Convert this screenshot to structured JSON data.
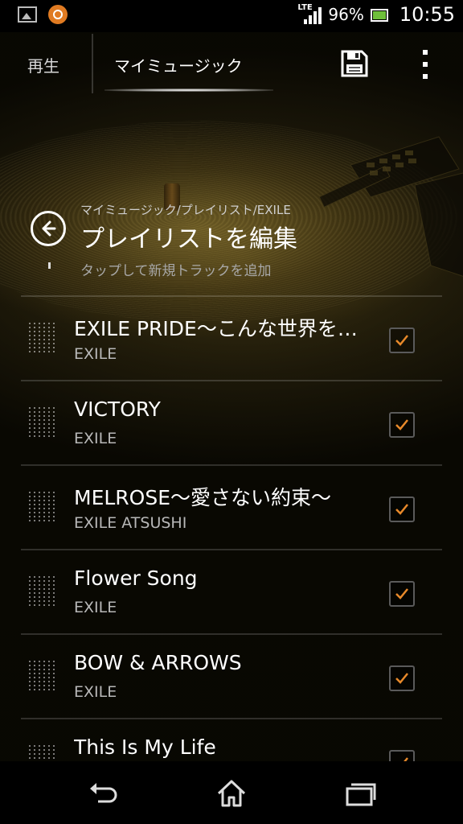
{
  "status_bar": {
    "network": "LTE",
    "battery_percent": "96%",
    "time": "10:55"
  },
  "action_bar": {
    "tab_play": "再生",
    "tab_my_music": "マイミュージック"
  },
  "header": {
    "breadcrumb": "マイミュージック/プレイリスト/EXILE",
    "title": "プレイリストを編集",
    "add_track": "タップして新規トラックを追加"
  },
  "tracks": [
    {
      "title": "EXILE PRIDE～こんな世界を…",
      "artist": "EXILE",
      "checked": true
    },
    {
      "title": "VICTORY",
      "artist": "EXILE",
      "checked": true
    },
    {
      "title": "MELROSE～愛さない約束～",
      "artist": "EXILE ATSUSHI",
      "checked": true
    },
    {
      "title": "Flower Song",
      "artist": "EXILE",
      "checked": true
    },
    {
      "title": "BOW & ARROWS",
      "artist": "EXILE",
      "checked": true
    },
    {
      "title": "This Is My Life",
      "artist": "",
      "checked": true
    }
  ],
  "colors": {
    "accent": "#e8892a",
    "background": "#1a170a"
  }
}
